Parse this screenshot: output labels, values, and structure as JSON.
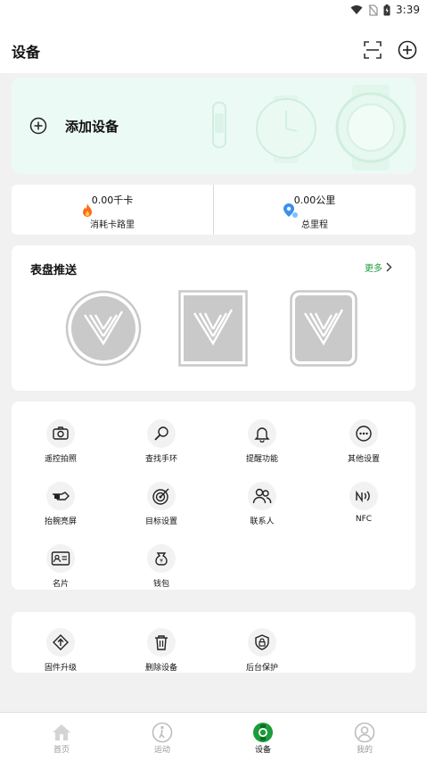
{
  "status_bar": {
    "time": "3:39"
  },
  "header": {
    "title": "设备"
  },
  "add_device": {
    "label": "添加设备"
  },
  "stats": {
    "calories": {
      "value": "0.00千卡",
      "label": "消耗卡路里"
    },
    "distance": {
      "value": "0.00公里",
      "label": "总里程"
    }
  },
  "watch_faces": {
    "title": "表盘推送",
    "more": "更多"
  },
  "functions": [
    {
      "label": "遥控拍照",
      "icon": "camera-icon"
    },
    {
      "label": "查找手环",
      "icon": "search-band-icon"
    },
    {
      "label": "提醒功能",
      "icon": "bell-icon"
    },
    {
      "label": "其他设置",
      "icon": "more-dots-icon"
    },
    {
      "label": "抬腕亮屏",
      "icon": "raise-wrist-icon"
    },
    {
      "label": "目标设置",
      "icon": "target-icon"
    },
    {
      "label": "联系人",
      "icon": "contacts-icon"
    },
    {
      "label": "NFC",
      "icon": "nfc-icon"
    },
    {
      "label": "名片",
      "icon": "business-card-icon"
    },
    {
      "label": "钱包",
      "icon": "wallet-icon"
    }
  ],
  "system": [
    {
      "label": "固件升级",
      "icon": "firmware-upgrade-icon"
    },
    {
      "label": "删除设备",
      "icon": "trash-icon"
    },
    {
      "label": "后台保护",
      "icon": "shield-lock-icon"
    }
  ],
  "tabs": [
    {
      "label": "首页",
      "icon": "home-icon"
    },
    {
      "label": "运动",
      "icon": "sport-icon"
    },
    {
      "label": "设备",
      "icon": "watch-icon",
      "active": true
    },
    {
      "label": "我的",
      "icon": "profile-icon"
    }
  ],
  "colors": {
    "accent": "#1a9c3a",
    "add_card_bg": "#ecfaf5",
    "fire": "#ff6a1a",
    "location": "#3b8ff0"
  }
}
